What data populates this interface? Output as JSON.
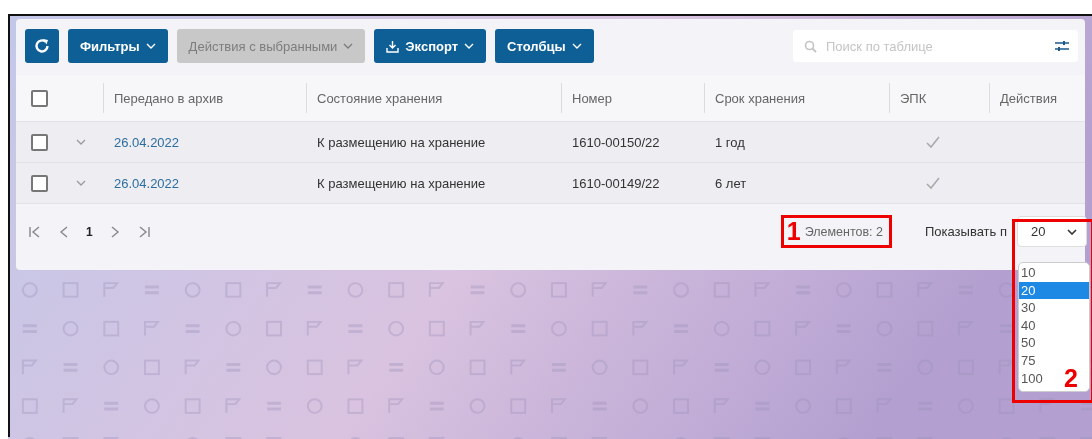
{
  "toolbar": {
    "buttons": [
      {
        "kind": "refresh",
        "disabled": false
      },
      {
        "kind": "menu",
        "label": "Фильтры",
        "disabled": false
      },
      {
        "kind": "menu",
        "label": "Действия с выбранными",
        "disabled": true
      },
      {
        "kind": "export",
        "label": "Экспорт",
        "disabled": false
      },
      {
        "kind": "menu",
        "label": "Столбцы",
        "disabled": false
      }
    ],
    "search": {
      "placeholder": "Поиск по таблице"
    }
  },
  "table": {
    "select_all": {
      "checked": false
    },
    "columns": [
      "Передано в архив",
      "Состояние хранения",
      "Номер",
      "Срок хранения",
      "ЭПК",
      "Действия"
    ],
    "rows": [
      {
        "checked": false,
        "expanded": false,
        "date": "26.04.2022",
        "state": "К размещению на хранение",
        "number": "1610-00150/22",
        "term": "1 год",
        "epk": true
      },
      {
        "checked": false,
        "expanded": false,
        "date": "26.04.2022",
        "state": "К размещению на хранение",
        "number": "1610-00149/22",
        "term": "6 лет",
        "epk": true
      }
    ]
  },
  "pagination": {
    "page": "1",
    "count": "Элементов: 2",
    "page_size_label": "Показывать п",
    "page_size": "20",
    "options": [
      {
        "label": "10",
        "selected": false
      },
      {
        "label": "20",
        "selected": true
      },
      {
        "label": "30",
        "selected": false
      },
      {
        "label": "40",
        "selected": false
      },
      {
        "label": "50",
        "selected": false
      },
      {
        "label": "75",
        "selected": false
      },
      {
        "label": "100",
        "selected": false
      }
    ]
  },
  "annotations": [
    {
      "label": "1"
    },
    {
      "label": "2"
    }
  ]
}
